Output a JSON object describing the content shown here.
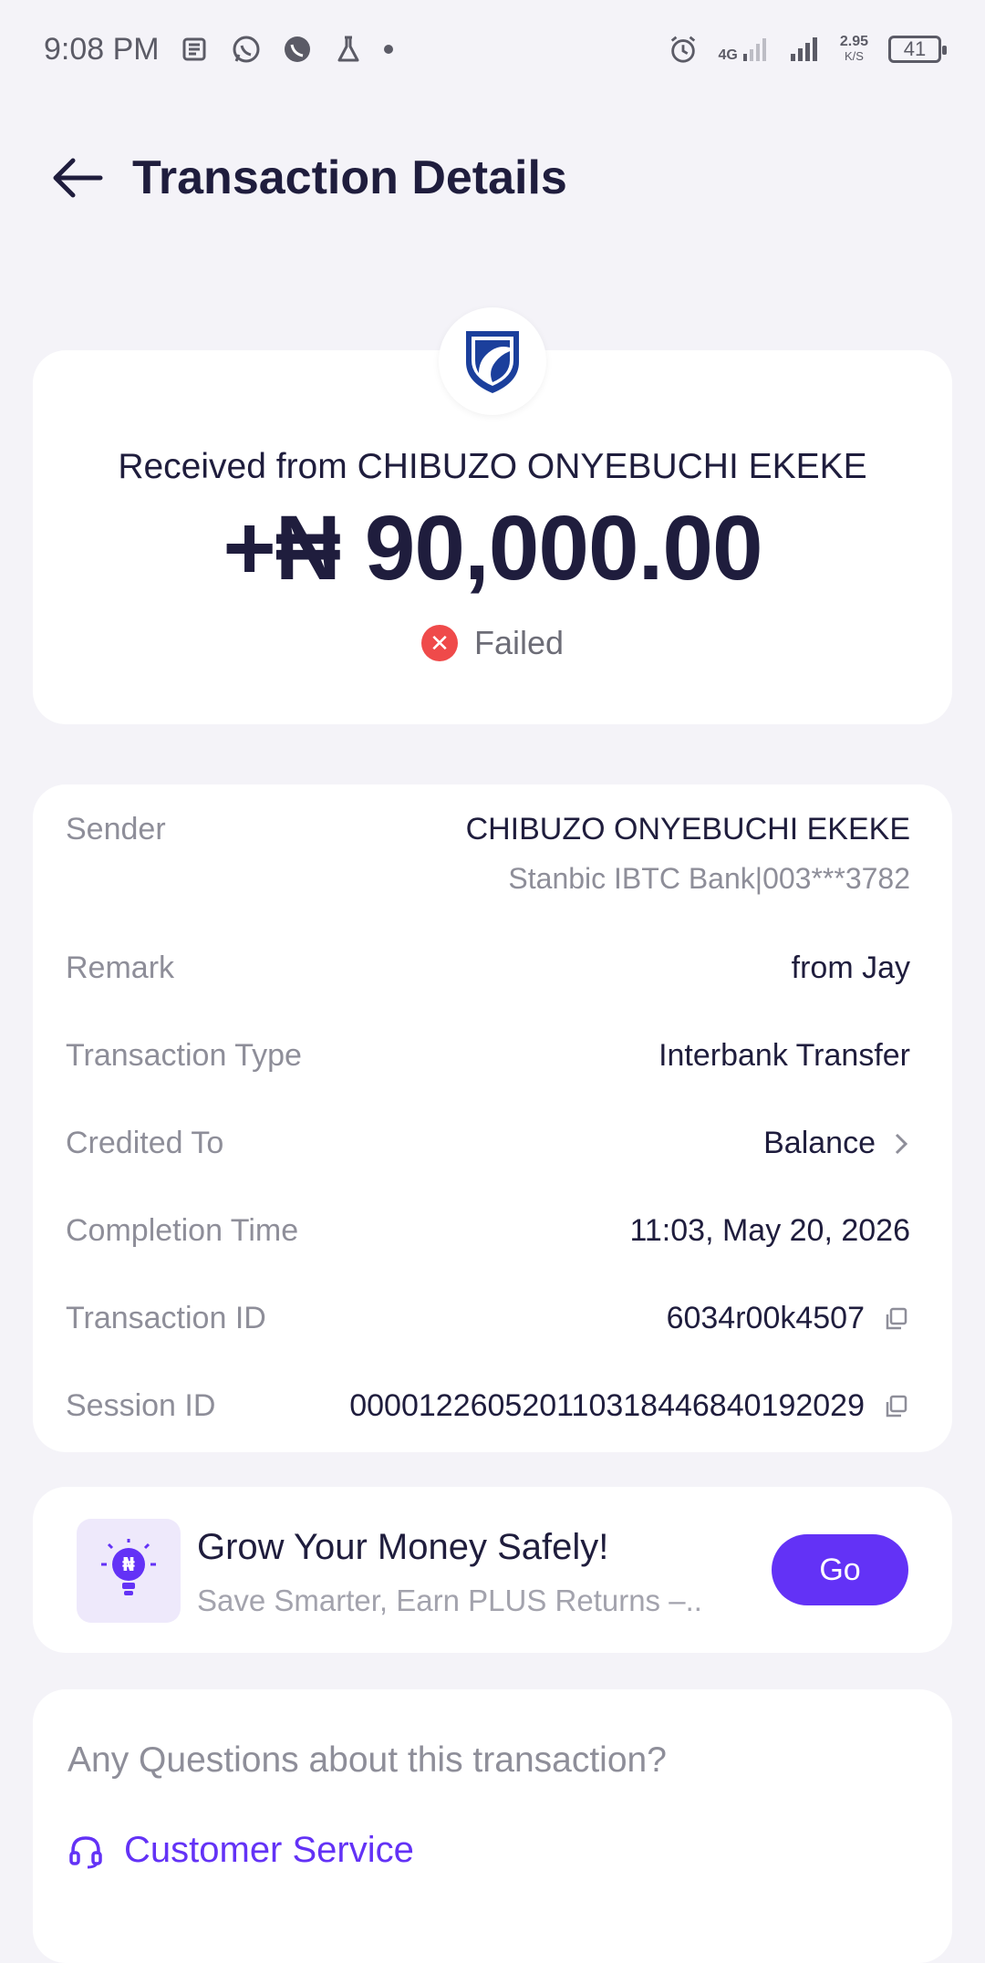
{
  "status_bar": {
    "time": "9:08 PM",
    "network_type": "4G",
    "speed_value": "2.95",
    "speed_unit": "K/S",
    "battery": "41",
    "icons": [
      "news-icon",
      "whatsapp-icon",
      "whatsapp-business-icon",
      "flask-icon",
      "alarm-icon",
      "signal-icon"
    ]
  },
  "header": {
    "title": "Transaction Details"
  },
  "summary": {
    "received_from": "Received from CHIBUZO ONYEBUCHI EKEKE",
    "amount": "+₦ 90,000.00",
    "status": "Failed",
    "status_color": "#ef4a4a"
  },
  "details": {
    "sender_label": "Sender",
    "sender_name": "CHIBUZO ONYEBUCHI EKEKE",
    "sender_bank": "Stanbic IBTC Bank|003***3782",
    "remark_label": "Remark",
    "remark_value": "from Jay",
    "type_label": "Transaction Type",
    "type_value": "Interbank Transfer",
    "credited_label": "Credited To",
    "credited_value": "Balance",
    "completion_label": "Completion Time",
    "completion_value": "11:03, May 20, 2026",
    "txn_id_label": "Transaction ID",
    "txn_id_value": "6034r00k4507",
    "session_label": "Session ID",
    "session_value": "000012260520110318446840192029"
  },
  "promo": {
    "title": "Grow Your Money Safely!",
    "subtitle": "Save Smarter, Earn PLUS Returns –..",
    "button": "Go",
    "accent": "#6332f6"
  },
  "help": {
    "question": "Any Questions about this transaction?",
    "customer_service": "Customer Service"
  }
}
